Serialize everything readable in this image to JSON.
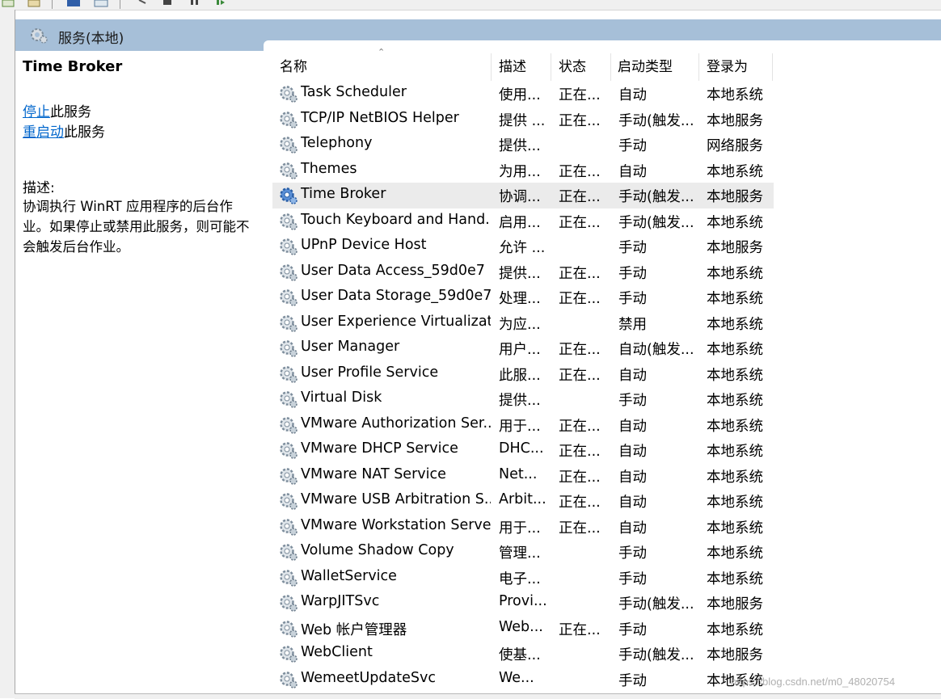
{
  "header": {
    "title": "服务(本地)"
  },
  "desc_pane": {
    "title": "Time Broker",
    "stop_link": "停止",
    "stop_suffix": "此服务",
    "restart_link": "重启动",
    "restart_suffix": "此服务",
    "desc_label": "描述:",
    "desc_text": "协调执行 WinRT 应用程序的后台作业。如果停止或禁用此服务，则可能不会触发后台作业。"
  },
  "list": {
    "columns": [
      "名称",
      "描述",
      "状态",
      "启动类型",
      "登录为"
    ],
    "rows": [
      {
        "name": "Task Scheduler",
        "desc": "使用...",
        "status": "正在...",
        "startup": "自动",
        "logon": "本地系统"
      },
      {
        "name": "TCP/IP NetBIOS Helper",
        "desc": "提供 ...",
        "status": "正在...",
        "startup": "手动(触发...",
        "logon": "本地服务"
      },
      {
        "name": "Telephony",
        "desc": "提供...",
        "status": "",
        "startup": "手动",
        "logon": "网络服务"
      },
      {
        "name": "Themes",
        "desc": "为用...",
        "status": "正在...",
        "startup": "自动",
        "logon": "本地系统"
      },
      {
        "name": "Time Broker",
        "desc": "协调...",
        "status": "正在...",
        "startup": "手动(触发...",
        "logon": "本地服务",
        "selected": true
      },
      {
        "name": "Touch Keyboard and Hand...",
        "desc": "启用...",
        "status": "正在...",
        "startup": "手动(触发...",
        "logon": "本地系统"
      },
      {
        "name": "UPnP Device Host",
        "desc": "允许 ...",
        "status": "",
        "startup": "手动",
        "logon": "本地服务"
      },
      {
        "name": "User Data Access_59d0e7",
        "desc": "提供...",
        "status": "正在...",
        "startup": "手动",
        "logon": "本地系统"
      },
      {
        "name": "User Data Storage_59d0e7",
        "desc": "处理...",
        "status": "正在...",
        "startup": "手动",
        "logon": "本地系统"
      },
      {
        "name": "User Experience Virtualizat...",
        "desc": "为应...",
        "status": "",
        "startup": "禁用",
        "logon": "本地系统"
      },
      {
        "name": "User Manager",
        "desc": "用户...",
        "status": "正在...",
        "startup": "自动(触发...",
        "logon": "本地系统"
      },
      {
        "name": "User Profile Service",
        "desc": "此服...",
        "status": "正在...",
        "startup": "自动",
        "logon": "本地系统"
      },
      {
        "name": "Virtual Disk",
        "desc": "提供...",
        "status": "",
        "startup": "手动",
        "logon": "本地系统"
      },
      {
        "name": "VMware Authorization Ser...",
        "desc": "用于...",
        "status": "正在...",
        "startup": "自动",
        "logon": "本地系统"
      },
      {
        "name": "VMware DHCP Service",
        "desc": "DHC...",
        "status": "正在...",
        "startup": "自动",
        "logon": "本地系统"
      },
      {
        "name": "VMware NAT Service",
        "desc": "Net...",
        "status": "正在...",
        "startup": "自动",
        "logon": "本地系统"
      },
      {
        "name": "VMware USB Arbitration S...",
        "desc": "Arbit...",
        "status": "正在...",
        "startup": "自动",
        "logon": "本地系统"
      },
      {
        "name": "VMware Workstation Server",
        "desc": "用于...",
        "status": "正在...",
        "startup": "自动",
        "logon": "本地系统"
      },
      {
        "name": "Volume Shadow Copy",
        "desc": "管理...",
        "status": "",
        "startup": "手动",
        "logon": "本地系统"
      },
      {
        "name": "WalletService",
        "desc": "电子...",
        "status": "",
        "startup": "手动",
        "logon": "本地系统"
      },
      {
        "name": "WarpJITSvc",
        "desc": "Provi...",
        "status": "",
        "startup": "手动(触发...",
        "logon": "本地服务"
      },
      {
        "name": "Web 帐户管理器",
        "desc": "Web...",
        "status": "正在...",
        "startup": "手动",
        "logon": "本地系统"
      },
      {
        "name": "WebClient",
        "desc": "使基...",
        "status": "",
        "startup": "手动(触发...",
        "logon": "本地服务"
      },
      {
        "name": "WemeetUpdateSvc",
        "desc": "We...",
        "status": "",
        "startup": "手动",
        "logon": "本地系统"
      }
    ]
  },
  "watermark": "https://blog.csdn.net/m0_48020754",
  "colors": {
    "header_bg": "#a6bfd8",
    "link": "#0066cc",
    "selected_row": "#ebebeb"
  }
}
